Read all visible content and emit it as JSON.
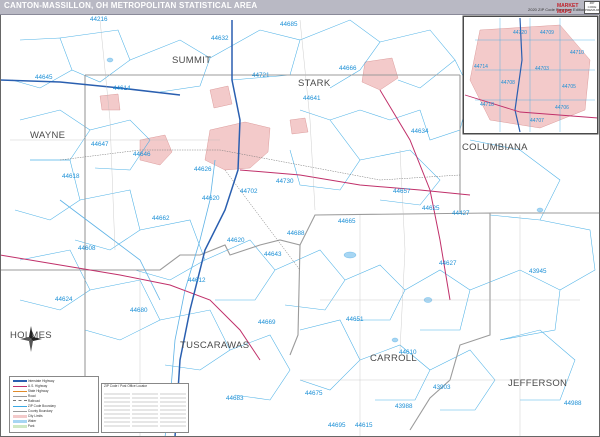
{
  "header": {
    "title": "CANTON-MASSILLON, OH METROPOLITAN STATISTICAL AREA",
    "edition": "2020 ZIP Code Premium Edition",
    "logo_text": "MARKET MAPS",
    "badge_text": "ZIP CODE PREMIUM"
  },
  "counties": [
    {
      "name": "SUMMIT"
    },
    {
      "name": "STARK"
    },
    {
      "name": "WAYNE"
    },
    {
      "name": "COLUMBIANA"
    },
    {
      "name": "HOLMES"
    },
    {
      "name": "TUSCARAWAS"
    },
    {
      "name": "CARROLL"
    },
    {
      "name": "JEFFERSON"
    }
  ],
  "zip_labels": [
    "44216",
    "44614",
    "44632",
    "44685",
    "44721",
    "44641",
    "44645",
    "44646",
    "44647",
    "44618",
    "44612",
    "44702",
    "44730",
    "44657",
    "44625",
    "44427",
    "44624",
    "44629",
    "44643",
    "44665",
    "44627",
    "44626",
    "44688",
    "44669",
    "44651",
    "44680",
    "44683",
    "44675",
    "44615",
    "44610",
    "43903",
    "43988",
    "43945",
    "44988",
    "44695",
    "44634",
    "44666",
    "44620",
    "44662",
    "44608",
    "44620"
  ],
  "inset_zip_labels": [
    "44720",
    "44714",
    "44718",
    "44709",
    "44708",
    "44703",
    "44707",
    "44705",
    "44706",
    "44710"
  ],
  "legend": {
    "rows": [
      "Interstate Highway",
      "U.S. Highway",
      "State Highway",
      "Road",
      "Railroad",
      "ZIP Code Boundary",
      "County Boundary",
      "City Limits",
      "Water",
      "Park"
    ]
  },
  "index": {
    "title": "ZIP Code / Post Office Locator"
  },
  "colors": {
    "title_bar": "#b9b9c4",
    "zip_boundary": "#2fa8e3",
    "county_boundary": "#9a9a9a",
    "interstate": "#2a5fb0",
    "us_highway": "#c0306a",
    "urban": "#f4c9c9",
    "water": "#9fd1f0",
    "zip_text": "#1a8fd6"
  }
}
